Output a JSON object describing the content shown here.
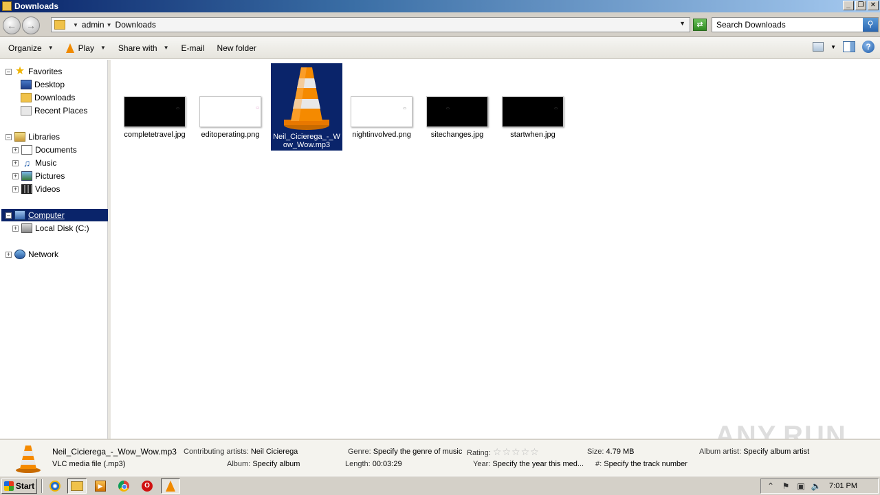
{
  "window": {
    "title": "Downloads",
    "min": "_",
    "restore": "❐",
    "close": "✕"
  },
  "address": {
    "crumbs": [
      "admin",
      "Downloads"
    ],
    "search_placeholder": "Search Downloads"
  },
  "toolbar": {
    "organize": "Organize",
    "play": "Play",
    "share_with": "Share with",
    "email": "E-mail",
    "new_folder": "New folder"
  },
  "nav": {
    "favorites": "Favorites",
    "desktop": "Desktop",
    "downloads": "Downloads",
    "recent_places": "Recent Places",
    "libraries": "Libraries",
    "documents": "Documents",
    "music": "Music",
    "pictures": "Pictures",
    "videos": "Videos",
    "computer": "Computer",
    "local_disk": "Local Disk (C:)",
    "network": "Network"
  },
  "files": [
    {
      "name": "completetravel.jpg",
      "kind": "black"
    },
    {
      "name": "editoperating.png",
      "kind": "white"
    },
    {
      "name_line1": "Neil_Cicierega_-_W",
      "name_line2": "ow_Wow.mp3",
      "kind": "vlc"
    },
    {
      "name": "nightinvolved.png",
      "kind": "white"
    },
    {
      "name": "sitechanges.jpg",
      "kind": "black"
    },
    {
      "name": "startwhen.jpg",
      "kind": "black"
    }
  ],
  "details": {
    "filename": "Neil_Cicierega_-_Wow_Wow.mp3",
    "filetype": "VLC media file (.mp3)",
    "contributing_artists_label": "Contributing artists:",
    "contributing_artists": "Neil Cicierega",
    "album_label": "Album:",
    "album": "Specify album",
    "genre_label": "Genre:",
    "genre": "Specify the genre of music",
    "length_label": "Length:",
    "length": "00:03:29",
    "rating_label": "Rating:",
    "rating_stars": "☆☆☆☆☆",
    "year_label": "Year:",
    "year": "Specify the year this med...",
    "size_label": "Size:",
    "size": "4.79 MB",
    "track_label": "#:",
    "track": "Specify the track number",
    "album_artist_label": "Album artist:",
    "album_artist": "Specify album artist"
  },
  "taskbar": {
    "start": "Start",
    "clock": "7:01 PM",
    "opera_glyph": "O"
  },
  "watermark": "ANY.RUN"
}
